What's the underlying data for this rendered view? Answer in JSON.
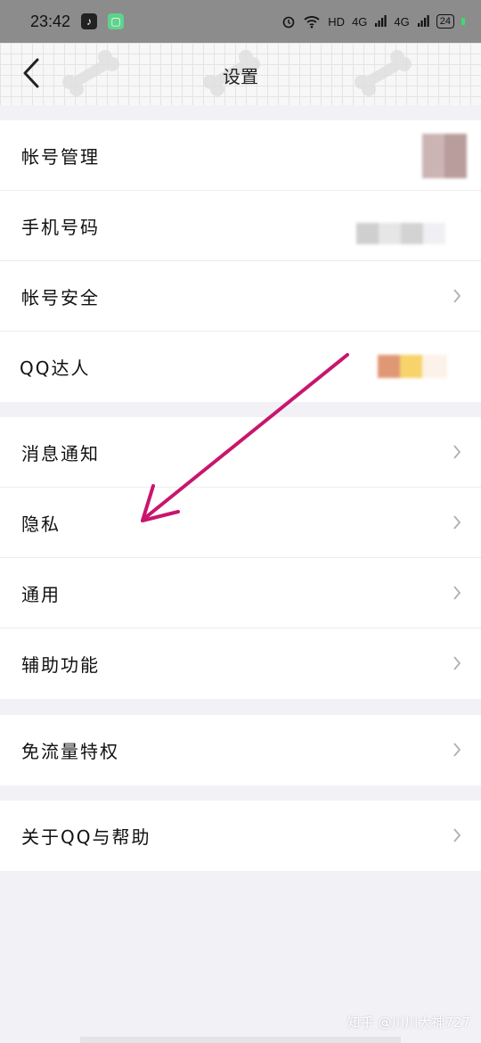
{
  "status_bar": {
    "time": "23:42",
    "app_icons": [
      "tiktok-icon",
      "chat-app-icon"
    ],
    "indicators": [
      "alarm-icon",
      "wifi-icon",
      "HD",
      "4G",
      "4G"
    ],
    "hd_label": "HD",
    "net1": "4G",
    "net2": "4G",
    "battery": "24"
  },
  "header": {
    "title": "设置"
  },
  "groups": [
    {
      "items": [
        {
          "label": "帐号管理"
        },
        {
          "label": "手机号码"
        },
        {
          "label": "帐号安全"
        },
        {
          "label": "QQ达人"
        }
      ]
    },
    {
      "items": [
        {
          "label": "消息通知"
        },
        {
          "label": "隐私"
        },
        {
          "label": "通用"
        },
        {
          "label": "辅助功能"
        }
      ]
    },
    {
      "items": [
        {
          "label": "免流量特权"
        }
      ]
    },
    {
      "items": [
        {
          "label": "关于QQ与帮助"
        }
      ]
    }
  ],
  "annotation": {
    "color": "#c8166e"
  },
  "watermark": "知乎 @川川大神727"
}
